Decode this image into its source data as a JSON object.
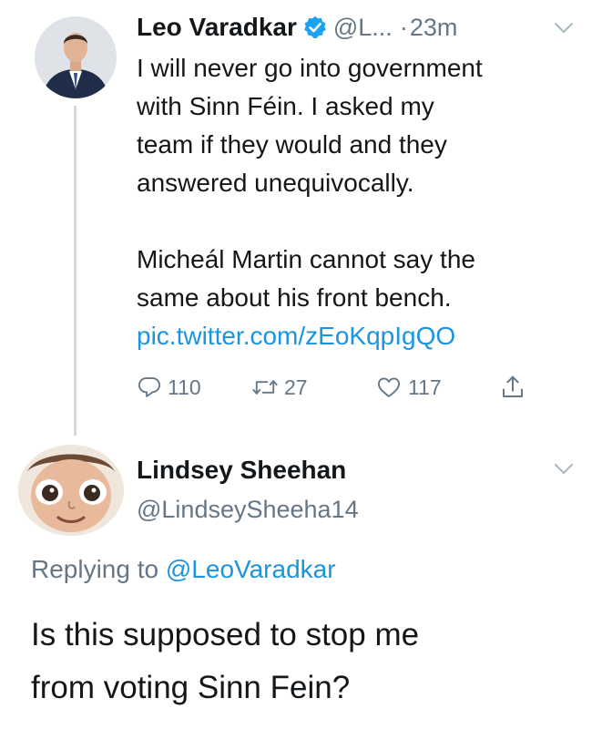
{
  "tweet": {
    "author_name": "Leo Varadkar",
    "author_handle": "@L...",
    "separator": "·",
    "time": "23m",
    "text_1": "I will never go into government\nwith Sinn Féin. I asked my\nteam if they would and they\nanswered unequivocally.",
    "text_2": "Micheál Martin cannot say the\nsame about his front bench.",
    "link": "pic.twitter.com/zEoKqpIgQO",
    "actions": {
      "replies": "110",
      "retweets": "27",
      "likes": "117"
    }
  },
  "reply": {
    "author_name": "Lindsey Sheehan",
    "author_handle": "@LindseySheeha14",
    "replying_prefix": "Replying to",
    "replying_to": "@LeoVaradkar",
    "text": "Is this supposed to stop me\nfrom voting Sinn Fein?"
  },
  "icons": {
    "verified": "verified-badge-icon",
    "chevron": "chevron-down-icon",
    "reply": "reply-icon",
    "retweet": "retweet-icon",
    "like": "heart-icon",
    "share": "share-icon"
  },
  "colors": {
    "link": "#1b95e0",
    "muted": "#657786",
    "text": "#14171a",
    "verified": "#1da1f2"
  }
}
